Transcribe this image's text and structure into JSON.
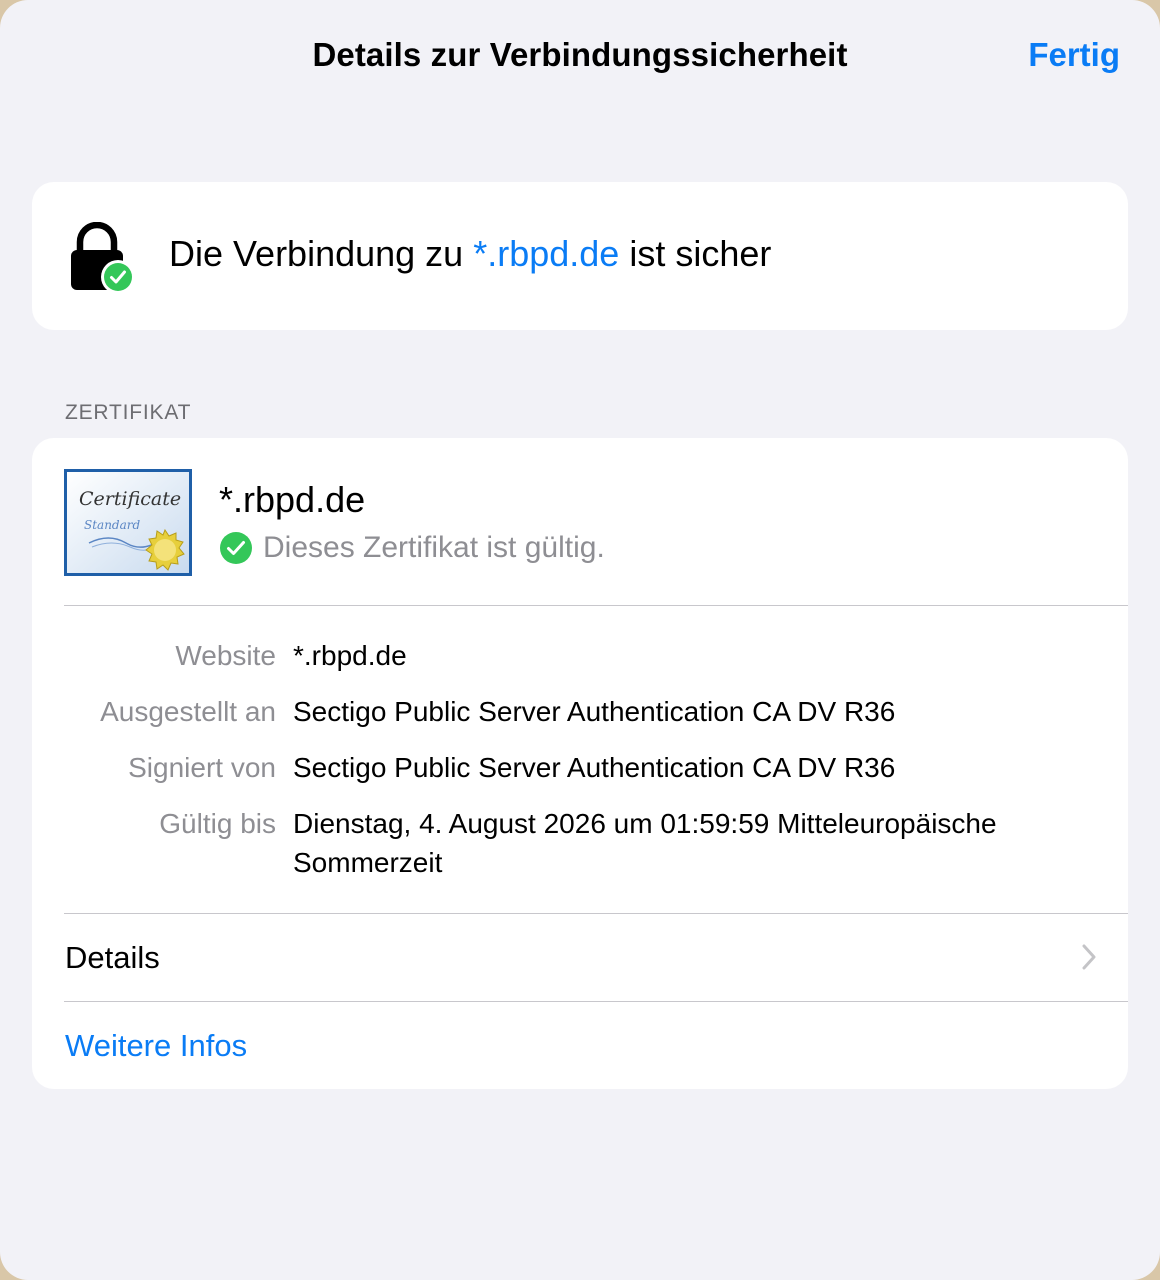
{
  "header": {
    "title": "Details zur Verbindungssicherheit",
    "done_label": "Fertig"
  },
  "status": {
    "prefix": "Die Verbindung zu ",
    "domain": "*.rbpd.de",
    "suffix": " ist sicher",
    "icon": "lock-check-icon"
  },
  "certificate": {
    "section_header": "ZERTIFIKAT",
    "thumbnail": {
      "title": "Certificate",
      "subtitle": "Standard"
    },
    "name": "*.rbpd.de",
    "valid_text": "Dieses Zertifikat ist gültig.",
    "fields": [
      {
        "label": "Website",
        "value": "*.rbpd.de"
      },
      {
        "label": "Ausgestellt an",
        "value": "Sectigo Public Server Authentication CA DV R36"
      },
      {
        "label": "Signiert von",
        "value": "Sectigo Public Server Authentication CA DV R36"
      },
      {
        "label": "Gültig bis",
        "value": "Dienstag, 4. August 2026 um 01:59:59 Mitteleuropäische Sommerzeit"
      }
    ],
    "details_label": "Details",
    "more_info_label": "Weitere Infos"
  },
  "colors": {
    "accent": "#0a7cf5",
    "success": "#34c759",
    "background": "#f2f2f7"
  }
}
